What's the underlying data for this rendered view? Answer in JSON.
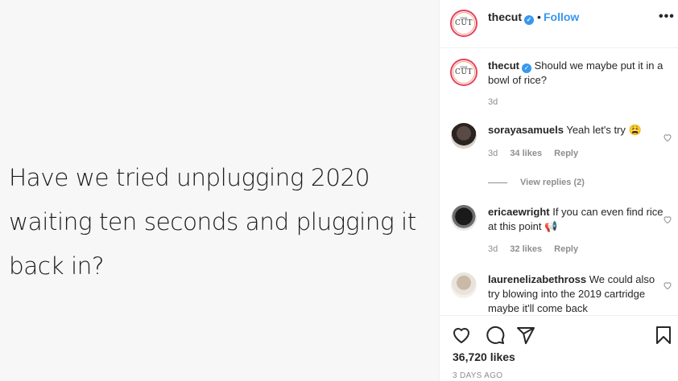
{
  "post": {
    "text_lines": [
      "Have we tried unplugging 2020",
      "waiting ten seconds and plugging it",
      "back in?"
    ]
  },
  "header": {
    "username": "thecut",
    "logo_text": "CUT",
    "logo_small": "THE",
    "separator": "•",
    "follow_label": "Follow",
    "more_label": "•••"
  },
  "caption": {
    "username": "thecut",
    "text": "Should we maybe put it in a bowl of rice?",
    "time": "3d"
  },
  "comments": [
    {
      "username": "sorayasamuels",
      "text": "Yeah let's try 😩",
      "time": "3d",
      "likes": "34 likes",
      "reply_label": "Reply"
    },
    {
      "username": "ericaewright",
      "text": "If you can even find rice at this point 📢",
      "time": "3d",
      "likes": "32 likes",
      "reply_label": "Reply"
    },
    {
      "username": "laurenelizabethross",
      "text": "We could also try blowing into the 2019 cartridge maybe it'll come back"
    }
  ],
  "view_replies": "View replies (2)",
  "likes": "36,720 likes",
  "timestamp": "3 DAYS AGO",
  "icons": [
    "heart-icon",
    "comment-icon",
    "share-icon",
    "bookmark-icon",
    "verified-badge-icon",
    "more-options-icon"
  ],
  "colors": {
    "link": "#3897f0",
    "muted": "#8e8e8e",
    "text": "#262626"
  }
}
